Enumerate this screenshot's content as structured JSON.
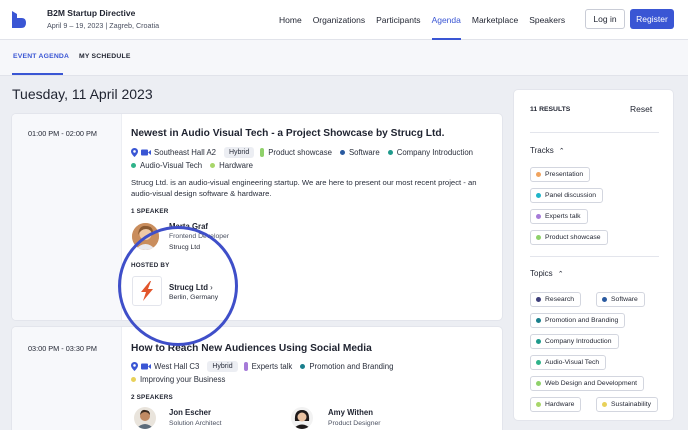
{
  "header": {
    "brand_title": "B2M Startup Directive",
    "brand_sub": "April 9 – 19, 2023 | Zagreb, Croatia",
    "nav": [
      "Home",
      "Organizations",
      "Participants",
      "Agenda",
      "Marketplace",
      "Speakers"
    ],
    "active_nav": "Agenda",
    "login": "Log in",
    "register": "Register"
  },
  "subnav": {
    "tab1": "EVENT AGENDA",
    "tab2": "MY SCHEDULE"
  },
  "date_heading": "Tuesday, 11 April 2023",
  "sessions": [
    {
      "time": "01:00 PM - 02:00 PM",
      "title": "Newest in Audio Visual Tech - a Project Showcase by Strucg Ltd.",
      "location": "Southeast Hall A2",
      "format": "Hybrid",
      "tags_row1": [
        "Product showcase",
        "Software",
        "Company Introduction"
      ],
      "tags_row2": [
        "Audio-Visual Tech",
        "Hardware"
      ],
      "description": "Strucg Ltd. is an audio-visual engineering startup. We are here to present our most recent project - an audio-visual design software & hardware.",
      "speakers_label": "1 SPEAKER",
      "speaker": {
        "name": "Marta Graf",
        "role": "Frontend Developer",
        "org": "Strucg Ltd"
      },
      "hosted_label": "HOSTED BY",
      "host": {
        "name": "Strucg Ltd",
        "location": "Berlin, Germany"
      }
    },
    {
      "time": "03:00 PM - 03:30 PM",
      "title": "How to Reach New Audiences Using Social Media",
      "location": "West Hall C3",
      "format": "Hybrid",
      "tags_row1": [
        "Experts talk",
        "Promotion and Branding"
      ],
      "tags_row2": [
        "Improving your Business"
      ],
      "speakers_label": "2 SPEAKERS",
      "speakers": [
        {
          "name": "Jon Escher",
          "role": "Solution Architect"
        },
        {
          "name": "Amy Withen",
          "role": "Product Designer"
        }
      ]
    }
  ],
  "sidebar": {
    "results": "11 RESULTS",
    "reset": "Reset",
    "tracks_title": "Tracks",
    "tracks": [
      "Presentation",
      "Panel discussion",
      "Experts talk",
      "Product showcase"
    ],
    "topics_title": "Topics",
    "topics": [
      "Research",
      "Software",
      "Promotion and Branding",
      "Company Introduction",
      "Audio-Visual Tech",
      "Web Design and Development",
      "Hardware",
      "Sustainability"
    ]
  },
  "colors": {
    "accent": "#3a56d4",
    "presentation": "#f0a35e",
    "panel_discussion": "#1fb5c9",
    "experts_talk": "#a67bd8",
    "product_showcase": "#8fd16a",
    "research": "#3d3f7a",
    "software": "#2a5aa0",
    "promotion": "#1a7f8c",
    "company_intro": "#1f9a8c",
    "av_tech": "#2fb38a",
    "web_design": "#8fd16a",
    "hardware": "#a8d66a",
    "sustainability": "#e8d15a"
  }
}
